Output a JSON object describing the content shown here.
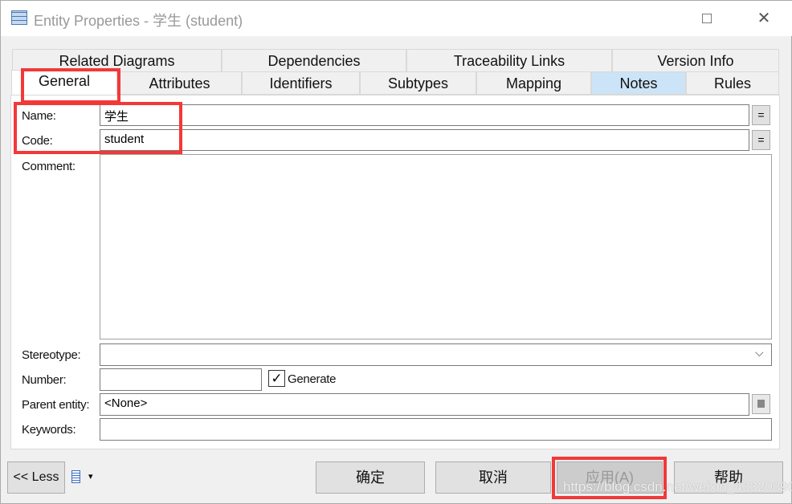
{
  "window": {
    "title": "Entity Properties - 学生 (student)",
    "icon": "entity-table-icon",
    "maximize_icon": "□",
    "close_icon": "✕"
  },
  "tabs_row1": [
    {
      "label": "Related Diagrams"
    },
    {
      "label": "Dependencies"
    },
    {
      "label": "Traceability Links"
    },
    {
      "label": "Version Info"
    }
  ],
  "tabs_row2": [
    {
      "label": "General"
    },
    {
      "label": "Attributes"
    },
    {
      "label": "Identifiers"
    },
    {
      "label": "Subtypes"
    },
    {
      "label": "Mapping"
    },
    {
      "label": "Notes"
    },
    {
      "label": "Rules"
    }
  ],
  "form": {
    "name_label": "Name:",
    "name_value": "学生",
    "code_label": "Code:",
    "code_value": "student",
    "eq_label": "=",
    "comment_label": "Comment:",
    "comment_value": "",
    "stereotype_label": "Stereotype:",
    "stereotype_value": "",
    "dropdown_icon": "⌵",
    "number_label": "Number:",
    "number_value": "",
    "generate_label": "Generate",
    "generate_checked": true,
    "check_icon": "✓",
    "parent_label": "Parent entity:",
    "parent_value": "<None>",
    "keywords_label": "Keywords:",
    "keywords_value": ""
  },
  "footer": {
    "less": "<< Less",
    "menu_icon": "▾",
    "ok": "确定",
    "cancel": "取消",
    "apply": "应用(A)",
    "help": "帮助"
  },
  "watermark": "https://blog.csdn.net/weixin_43320890",
  "colors": {
    "highlight": "#f23838",
    "notes_tab": "#cce4f7"
  }
}
